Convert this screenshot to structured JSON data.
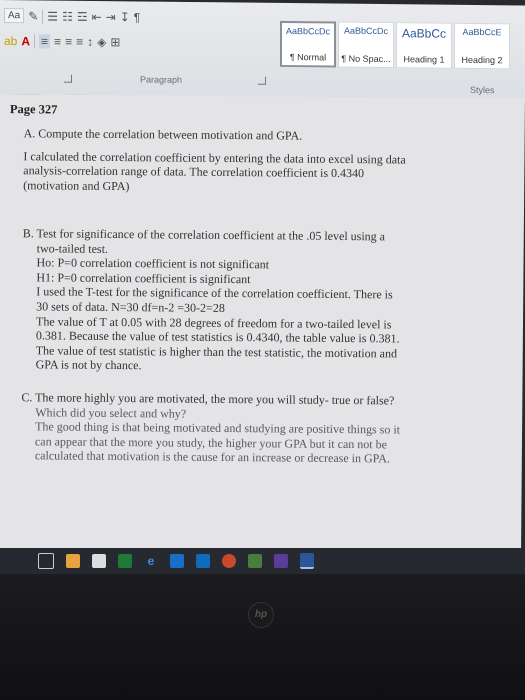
{
  "ribbon": {
    "font_size_button": "Aa",
    "paragraph_label": "Paragraph",
    "styles_label": "Styles",
    "styles": [
      {
        "sample": "AaBbCcDc",
        "name": "¶ Normal",
        "selected": true
      },
      {
        "sample": "AaBbCcDc",
        "name": "¶ No Spac...",
        "selected": false
      },
      {
        "sample": "AaBbCc",
        "name": "Heading 1",
        "selected": false
      },
      {
        "sample": "AaBbCcE",
        "name": "Heading 2",
        "selected": false
      }
    ]
  },
  "document": {
    "page": "Page 327",
    "sectionA": [
      "A. Compute the correlation between motivation and GPA.",
      "I calculated the correlation coefficient by entering the data into excel using data",
      "analysis-correlation range of data. The correlation coefficient is 0.4340",
      "(motivation and GPA)"
    ],
    "sectionB": [
      "B. Test for significance of the correlation coefficient at the .05 level using a",
      "two-tailed test.",
      "Ho: P=0 correlation coefficient is not significant",
      "H1: P=0 correlation coefficient is significant",
      "I used the T-test for the significance of the correlation coefficient. There is",
      "30 sets of data. N=30 df=n-2 =30-2=28",
      "The value of T at 0.05 with 28 degrees of freedom for a two-tailed level is",
      "0.381. Because the value of test statistics is 0.4340, the table value is 0.381.",
      "The value of test statistic is higher than the test statistic, the motivation and",
      "GPA is not by chance."
    ],
    "sectionC": [
      "C. The more highly you are motivated, the more you will study- true or false?",
      "Which did you select and why?",
      "The good thing is that being motivated and studying are positive things so it",
      "can appear that the more you study, the higher your GPA but it can not be",
      "calculated that motivation is the cause for an increase or decrease in GPA."
    ]
  },
  "bezel": {
    "logo": "hp"
  }
}
